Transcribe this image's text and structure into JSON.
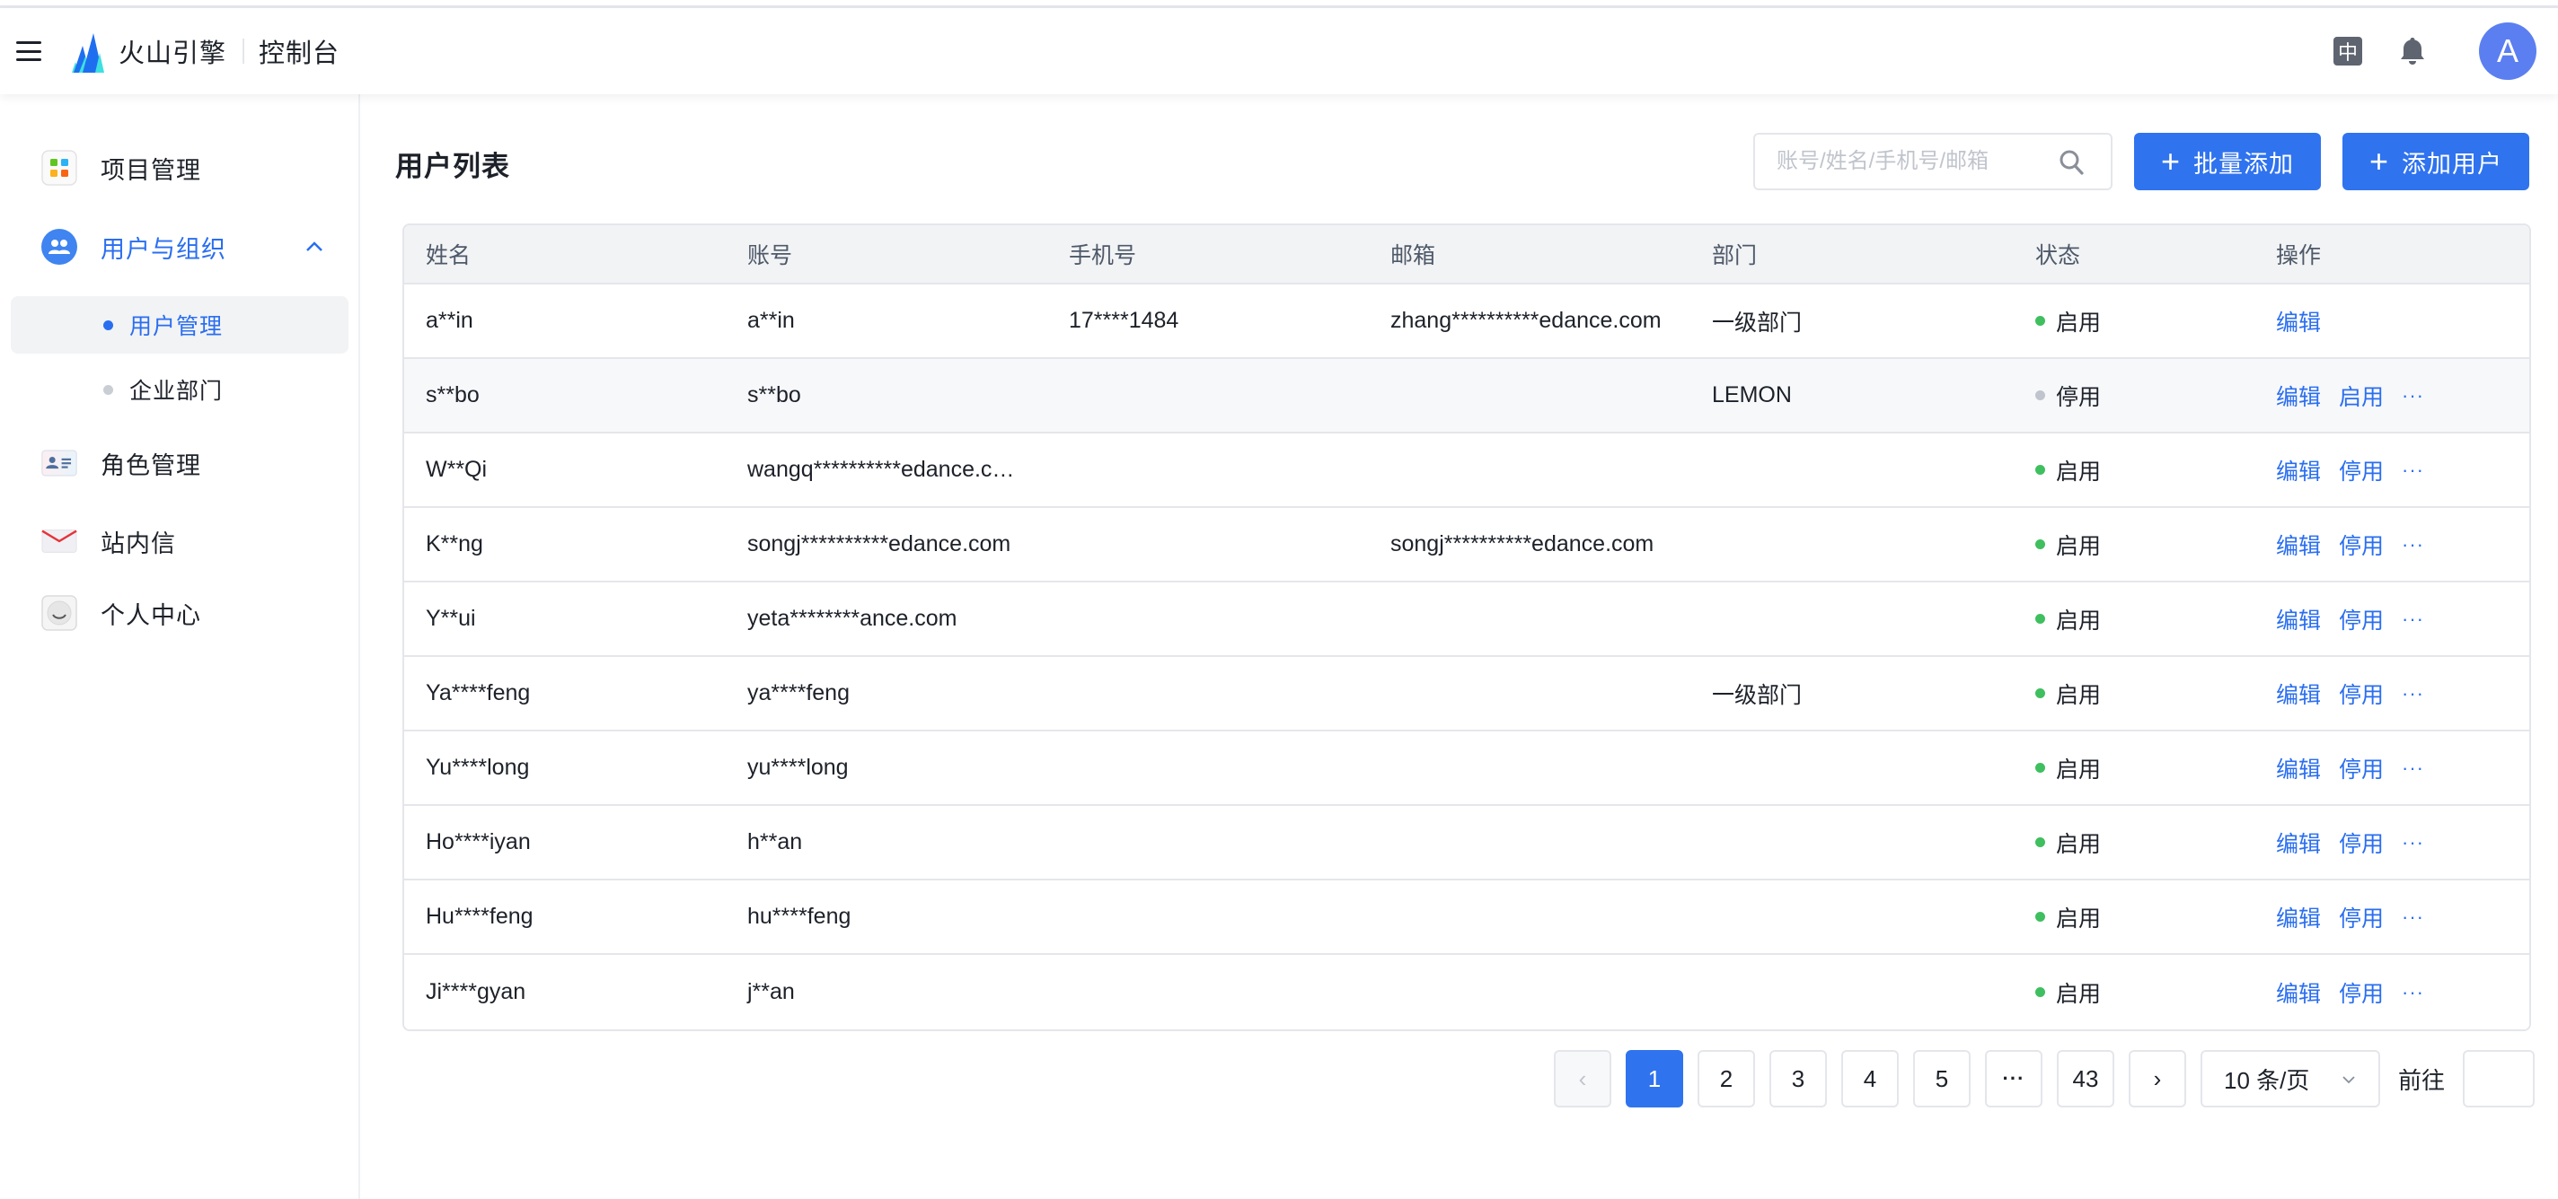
{
  "header": {
    "brand": "火山引擎",
    "console": "控制台",
    "lang_label": "中",
    "avatar_letter": "A"
  },
  "sidebar": {
    "items": [
      {
        "label": "项目管理",
        "icon": "project-grid-icon"
      },
      {
        "label": "用户与组织",
        "icon": "users-group-icon",
        "expanded": true
      },
      {
        "label": "角色管理",
        "icon": "role-card-icon"
      },
      {
        "label": "站内信",
        "icon": "mail-icon"
      },
      {
        "label": "个人中心",
        "icon": "personal-center-icon"
      }
    ],
    "subitems": [
      {
        "label": "用户管理",
        "selected": true
      },
      {
        "label": "企业部门",
        "selected": false
      }
    ]
  },
  "main": {
    "title": "用户列表",
    "search_placeholder": "账号/姓名/手机号/邮箱",
    "batch_add_label": "批量添加",
    "add_user_label": "添加用户"
  },
  "table": {
    "columns": [
      "姓名",
      "账号",
      "手机号",
      "邮箱",
      "部门",
      "状态",
      "操作"
    ],
    "rows": [
      {
        "name": "a**in",
        "account": "a**in",
        "phone": "17****1484",
        "email": "zhang**********edance.com",
        "dept": "一级部门",
        "status": "启用",
        "status_color": "#3fbf5f",
        "ops": [
          "编辑"
        ],
        "more": false
      },
      {
        "name": "s**bo",
        "account": "s**bo",
        "phone": "",
        "email": "",
        "dept": "LEMON",
        "status": "停用",
        "status_color": "#c0c4cc",
        "ops": [
          "编辑",
          "启用"
        ],
        "more": true
      },
      {
        "name": "W**Qi",
        "account": "wangq**********edance.c…",
        "phone": "",
        "email": "",
        "dept": "",
        "status": "启用",
        "status_color": "#3fbf5f",
        "ops": [
          "编辑",
          "停用"
        ],
        "more": true
      },
      {
        "name": "K**ng",
        "account": "songj**********edance.com",
        "phone": "",
        "email": "songj**********edance.com",
        "dept": "",
        "status": "启用",
        "status_color": "#3fbf5f",
        "ops": [
          "编辑",
          "停用"
        ],
        "more": true
      },
      {
        "name": "Y**ui",
        "account": "yeta********ance.com",
        "phone": "",
        "email": "",
        "dept": "",
        "status": "启用",
        "status_color": "#3fbf5f",
        "ops": [
          "编辑",
          "停用"
        ],
        "more": true
      },
      {
        "name": "Ya****feng",
        "account": "ya****feng",
        "phone": "",
        "email": "",
        "dept": "一级部门",
        "status": "启用",
        "status_color": "#3fbf5f",
        "ops": [
          "编辑",
          "停用"
        ],
        "more": true
      },
      {
        "name": "Yu****long",
        "account": "yu****long",
        "phone": "",
        "email": "",
        "dept": "",
        "status": "启用",
        "status_color": "#3fbf5f",
        "ops": [
          "编辑",
          "停用"
        ],
        "more": true
      },
      {
        "name": "Ho****iyan",
        "account": "h**an",
        "phone": "",
        "email": "",
        "dept": "",
        "status": "启用",
        "status_color": "#3fbf5f",
        "ops": [
          "编辑",
          "停用"
        ],
        "more": true
      },
      {
        "name": "Hu****feng",
        "account": "hu****feng",
        "phone": "",
        "email": "",
        "dept": "",
        "status": "启用",
        "status_color": "#3fbf5f",
        "ops": [
          "编辑",
          "停用"
        ],
        "more": true
      },
      {
        "name": "Ji****gyan",
        "account": "j**an",
        "phone": "",
        "email": "",
        "dept": "",
        "status": "启用",
        "status_color": "#3fbf5f",
        "ops": [
          "编辑",
          "停用"
        ],
        "more": true
      }
    ],
    "more_label": "···"
  },
  "pagination": {
    "prev": "‹",
    "next": "›",
    "pages": [
      "1",
      "2",
      "3",
      "4",
      "5"
    ],
    "current": "1",
    "ellipsis": "···",
    "last": "43",
    "page_size": "10 条/页",
    "goto_label": "前往",
    "goto_value": ""
  },
  "colors": {
    "primary": "#2f73ef",
    "link": "#2a6ef0",
    "enabled": "#3fbf5f",
    "disabled": "#c0c4cc",
    "avatar": "#5b7ff0"
  }
}
